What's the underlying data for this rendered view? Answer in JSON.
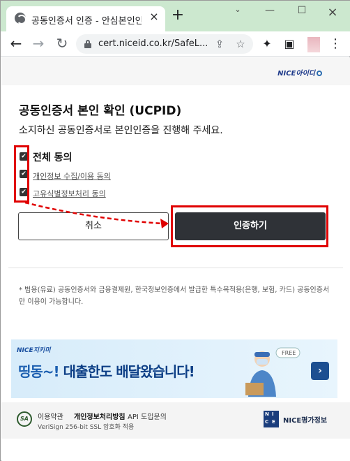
{
  "browser": {
    "tab_title": "공동인증서 인증 - 안심본인인",
    "tab_close": "×",
    "new_tab": "+",
    "url": "cert.niceid.co.kr/SafeL...",
    "window": {
      "dropdown": "⌄",
      "minimize": "—",
      "maximize": "☐",
      "close": "×"
    }
  },
  "brand": {
    "logo_text": "NICE아이디"
  },
  "page": {
    "title": "공동인증서 본인 확인 (UCPID)",
    "subtitle": "소지하신 공동인증서로 본인인증을 진행해 주세요.",
    "agree_all": "전체 동의",
    "agree_items": [
      "개인정보 수집/이용 동의",
      "고유식별정보처리 동의"
    ],
    "checks": [
      true,
      true,
      true
    ],
    "cancel_label": "취소",
    "confirm_label": "인증하기",
    "notice": "* 범용(유료) 공동인증서와 금융결제원, 한국정보인증에서 발급한 특수목적용(은행, 보험, 카드) 공동인증서만 이용이 가능합니다."
  },
  "banner": {
    "logo": "NICE지키미",
    "text_part1": "띵동~!",
    "text_part2": " 대출한도 배달왔습니다!",
    "free_tag": "FREE",
    "arrow": "›"
  },
  "footer": {
    "sa_logo": "SA",
    "terms": "이용약관",
    "privacy": "개인정보처리방침",
    "api": "API 도입문의",
    "ssl": "VeriSign 256-bit SSL 암호화 적용",
    "nice_company": "NICE평가정보"
  },
  "colors": {
    "titlebar": "#cce8cf",
    "confirm_button": "#2f3237",
    "highlight": "#e00000",
    "banner_text": "#1c5fb0"
  }
}
